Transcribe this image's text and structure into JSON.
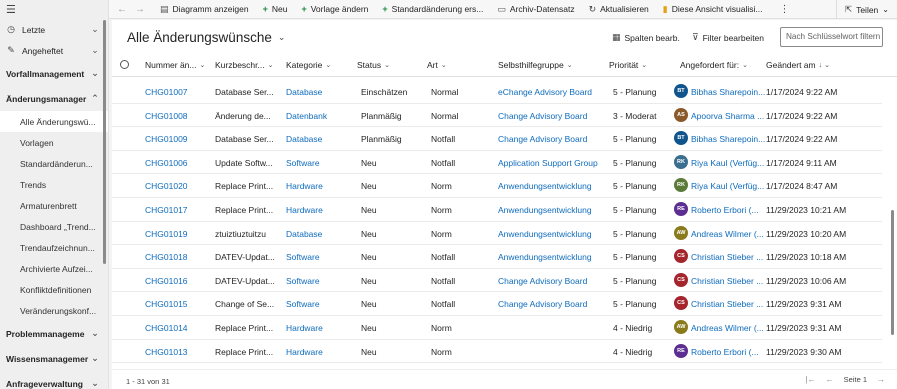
{
  "sidebar": {
    "menu_icon": "hamburger-icon",
    "items": [
      {
        "icon": "clock-icon",
        "label": "Letzte",
        "chev": "⌄"
      },
      {
        "icon": "pin-icon",
        "label": "Angeheftet",
        "chev": "⌄"
      }
    ],
    "groups": [
      {
        "label": "Vorfallmanagement",
        "chev": "⌄"
      },
      {
        "label": "Änderungsmanager",
        "chev": "⌃",
        "subitems": [
          {
            "label": "Alle Änderungswü...",
            "active": true
          },
          {
            "label": "Vorlagen"
          },
          {
            "label": "Standardänderun..."
          },
          {
            "label": "Trends"
          },
          {
            "label": "Armaturenbrett"
          },
          {
            "label": "Dashboard „Trend..."
          },
          {
            "label": "Trendaufzeichnun..."
          },
          {
            "label": "Archivierte Aufzei..."
          },
          {
            "label": "Konfliktdefinitionen"
          },
          {
            "label": "Veränderungskonf..."
          }
        ]
      },
      {
        "label": "Problemmanageme",
        "chev": "⌄"
      },
      {
        "label": "Wissensmanagemer",
        "chev": "⌄"
      },
      {
        "label": "Anfrageverwaltung",
        "chev": "⌄"
      }
    ]
  },
  "toolbar": {
    "back": "←",
    "forward": "→",
    "items": [
      {
        "icon": "chart-icon",
        "glyph": "▤",
        "label": "Diagramm anzeigen"
      },
      {
        "icon": "plus-icon",
        "glyph": "+",
        "label": "Neu"
      },
      {
        "icon": "plus-icon",
        "glyph": "+",
        "label": "Vorlage ändern"
      },
      {
        "icon": "plus-icon",
        "glyph": "+",
        "label": "Standardänderung ers..."
      },
      {
        "icon": "archive-icon",
        "glyph": "▭",
        "label": "Archiv-Datensatz"
      },
      {
        "icon": "refresh-icon",
        "glyph": "↻",
        "label": "Aktualisieren"
      },
      {
        "icon": "visualize-icon",
        "glyph": "▮",
        "label": "Diese Ansicht visualisi..."
      }
    ],
    "more": "⋮",
    "share_label": "Teilen",
    "share_chev": "⌄"
  },
  "view": {
    "title": "Alle Änderungswünsche",
    "title_chev": "⌄",
    "edit_columns": "Spalten bearb.",
    "edit_filters": "Filter bearbeiten",
    "search_placeholder": "Nach Schlüsselwort filtern"
  },
  "columns": [
    {
      "label": "Nummer än...",
      "chev": "⌄"
    },
    {
      "label": "Kurzbeschr...",
      "chev": "⌄"
    },
    {
      "label": "Kategorie",
      "chev": "⌄"
    },
    {
      "label": "Status",
      "chev": "⌄"
    },
    {
      "label": "Art",
      "chev": "⌄"
    },
    {
      "label": "Selbsthilfegruppe",
      "chev": "⌄"
    },
    {
      "label": "Priorität",
      "chev": "⌄"
    },
    {
      "label": "Angefordert für:",
      "chev": "⌄"
    },
    {
      "label": "Geändert am",
      "chev": "↓ ⌄"
    }
  ],
  "rows": [
    {
      "num": "CHG01007",
      "desc": "Database Ser...",
      "cat": "Database",
      "status": "Einschätzen",
      "type": "Normal",
      "group": "eChange Advisory Board",
      "prio": "5 - Planung",
      "avatar": "BT",
      "avatar_color": "#0f548c",
      "owner": "Bibhas Sharepoin...",
      "date": "1/17/2024 9:22 AM"
    },
    {
      "num": "CHG01008",
      "desc": "Änderung de...",
      "cat": "Datenbank",
      "status": "Planmäßig",
      "type": "Normal",
      "group": "Change Advisory Board",
      "prio": "3 - Moderat",
      "avatar": "AS",
      "avatar_color": "#8b5a2b",
      "owner": "Apoorva Sharma ...",
      "date": "1/17/2024 9:22 AM"
    },
    {
      "num": "CHG01009",
      "desc": "Database Ser...",
      "cat": "Database",
      "status": "Planmäßig",
      "type": "Notfall",
      "group": "Change Advisory Board",
      "prio": "5 - Planung",
      "avatar": "BT",
      "avatar_color": "#0f548c",
      "owner": "Bibhas Sharepoin...",
      "date": "1/17/2024 9:22 AM"
    },
    {
      "num": "CHG01006",
      "desc": "Update Softw...",
      "cat": "Software",
      "status": "Neu",
      "type": "Notfall",
      "group": "Application Support Group",
      "prio": "5 - Planung",
      "avatar": "RK",
      "avatar_color": "#3b6e8f",
      "owner": "Riya Kaul (Verfüg...",
      "date": "1/17/2024 9:11 AM"
    },
    {
      "num": "CHG01020",
      "desc": "Replace Print...",
      "cat": "Hardware",
      "status": "Neu",
      "type": "Norm",
      "group": "Anwendungsentwicklung",
      "prio": "5 - Planung",
      "avatar": "RK",
      "avatar_color": "#5a7a3a",
      "owner": "Riya Kaul (Verfüg...",
      "date": "1/17/2024 8:47 AM"
    },
    {
      "num": "CHG01017",
      "desc": "Replace Print...",
      "cat": "Hardware",
      "status": "Neu",
      "type": "Norm",
      "group": "Anwendungsentwicklung",
      "prio": "5 - Planung",
      "avatar": "RE",
      "avatar_color": "#5c2e91",
      "owner": "Roberto Erbori (...",
      "date": "11/29/2023 10:21 AM"
    },
    {
      "num": "CHG01019",
      "desc": "ztuiztiuztuitzu",
      "cat": "Database",
      "status": "Neu",
      "type": "Norm",
      "group": "Anwendungsentwicklung",
      "prio": "5 - Planung",
      "avatar": "AW",
      "avatar_color": "#8a7a1e",
      "owner": "Andreas Wilmer (...",
      "date": "11/29/2023 10:20 AM"
    },
    {
      "num": "CHG01018",
      "desc": "DATEV-Updat...",
      "cat": "Software",
      "status": "Neu",
      "type": "Notfall",
      "group": "Anwendungsentwicklung",
      "prio": "5 - Planung",
      "avatar": "CS",
      "avatar_color": "#a4262c",
      "owner": "Christian Stieber ...",
      "date": "11/29/2023 10:18 AM"
    },
    {
      "num": "CHG01016",
      "desc": "DATEV-Updat...",
      "cat": "Software",
      "status": "Neu",
      "type": "Notfall",
      "group": "Change Advisory Board",
      "prio": "5 - Planung",
      "avatar": "CS",
      "avatar_color": "#a4262c",
      "owner": "Christian Stieber ...",
      "date": "11/29/2023 10:06 AM"
    },
    {
      "num": "CHG01015",
      "desc": "Change of Se...",
      "cat": "Software",
      "status": "Neu",
      "type": "Notfall",
      "group": "Change Advisory Board",
      "prio": "5 - Planung",
      "avatar": "CS",
      "avatar_color": "#a4262c",
      "owner": "Christian Stieber ...",
      "date": "11/29/2023 9:31 AM"
    },
    {
      "num": "CHG01014",
      "desc": "Replace Print...",
      "cat": "Hardware",
      "status": "Neu",
      "type": "Norm",
      "group": "",
      "prio": "4 - Niedrig",
      "avatar": "AW",
      "avatar_color": "#8a7a1e",
      "owner": "Andreas Wilmer (...",
      "date": "11/29/2023 9:31 AM"
    },
    {
      "num": "CHG01013",
      "desc": "Replace Print...",
      "cat": "Hardware",
      "status": "Neu",
      "type": "Norm",
      "group": "",
      "prio": "4 - Niedrig",
      "avatar": "RE",
      "avatar_color": "#5c2e91",
      "owner": "Roberto Erbori (...",
      "date": "11/29/2023 9:30 AM"
    }
  ],
  "footer": {
    "count": "1 - 31 von 31",
    "first": "|←",
    "prev": "←",
    "page": "Seite 1",
    "next": "→"
  }
}
